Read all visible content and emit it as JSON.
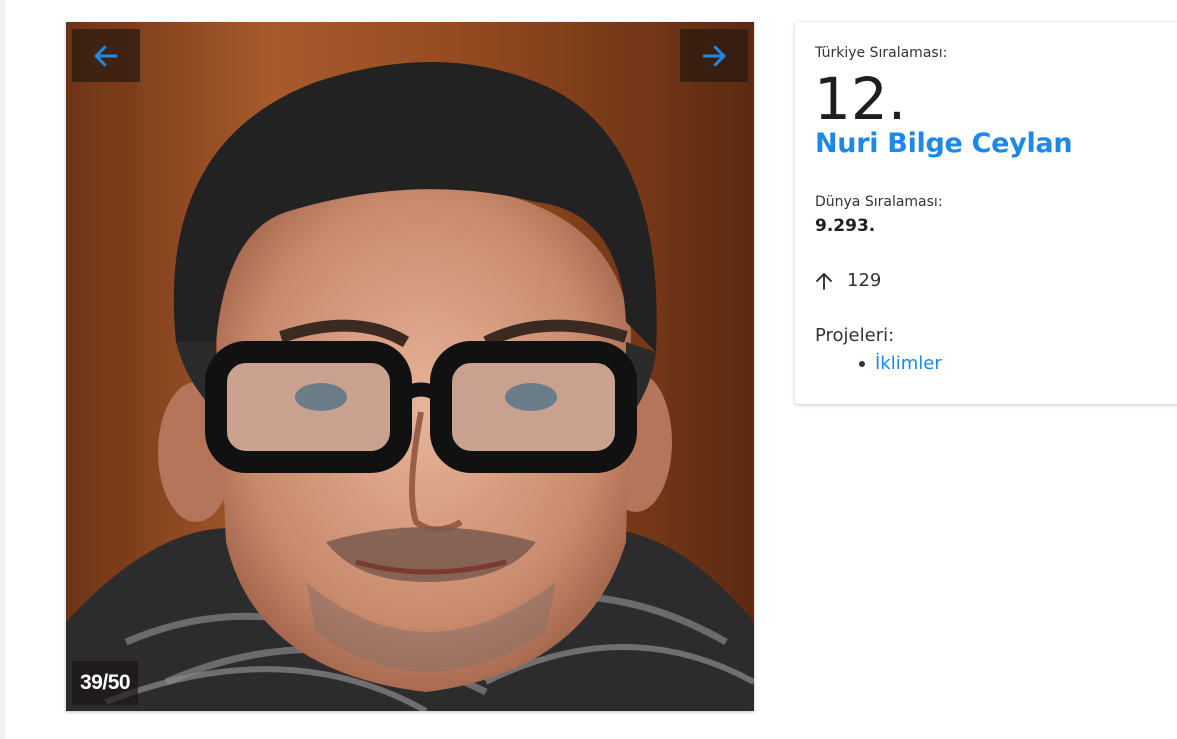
{
  "gallery": {
    "counter": "39/50",
    "prev_icon": "arrow-left-icon",
    "next_icon": "arrow-right-icon",
    "accent": "#1e88e5"
  },
  "card": {
    "turkey_rank_label": "Türkiye Sıralaması:",
    "turkey_rank": "12.",
    "name": "Nuri Bilge Ceylan",
    "world_rank_label": "Dünya Sıralaması:",
    "world_rank": "9.293.",
    "change_icon": "arrow-up-icon",
    "change_value": "129",
    "projects_label": "Projeleri:",
    "projects": [
      "İklimler"
    ]
  }
}
